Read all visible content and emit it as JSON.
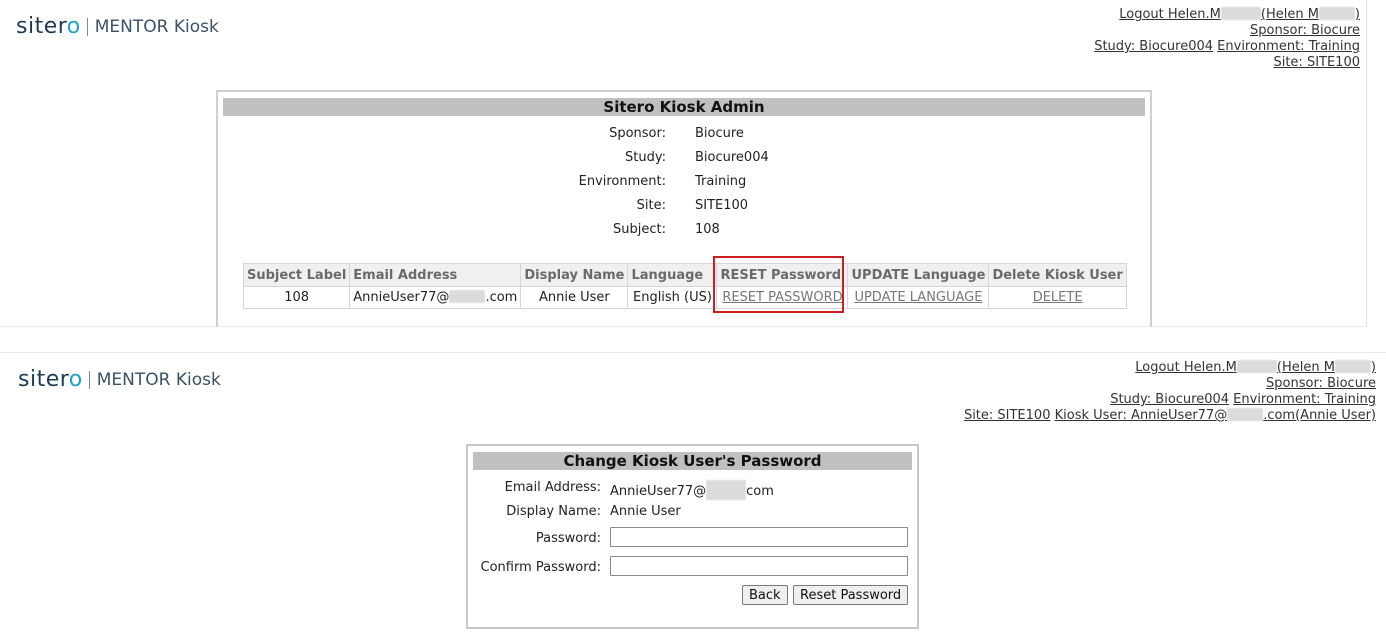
{
  "brand": {
    "name_left": "siter",
    "name_o": "o",
    "product": "MENTOR Kiosk"
  },
  "panel1": {
    "header": {
      "logout": "Logout Helen.M",
      "user_paren_open": "(Helen M",
      "user_paren_close": ")",
      "sponsor_link": "Sponsor: Biocure",
      "study_link": "Study: Biocure004",
      "environment_link": "Environment: Training",
      "site_link": "Site: SITE100"
    },
    "title": "Sitero Kiosk Admin",
    "details": [
      {
        "label": "Sponsor:",
        "value": "Biocure"
      },
      {
        "label": "Study:",
        "value": "Biocure004"
      },
      {
        "label": "Environment:",
        "value": "Training"
      },
      {
        "label": "Site:",
        "value": "SITE100"
      },
      {
        "label": "Subject:",
        "value": "108"
      }
    ],
    "table": {
      "headers": [
        "Subject Label",
        "Email Address",
        "Display Name",
        "Language",
        "RESET Password",
        "UPDATE Language",
        "Delete Kiosk User"
      ],
      "row": {
        "subject_label": "108",
        "email_prefix": "AnnieUser77@",
        "email_suffix": ".com",
        "display_name": "Annie User",
        "language": "English (US)",
        "reset_link": "RESET PASSWORD",
        "update_link": "UPDATE LANGUAGE",
        "delete_link": "DELETE"
      }
    },
    "highlight_color": "#cc1f1f"
  },
  "panel2": {
    "header": {
      "logout": "Logout Helen.M",
      "user_paren_open": "(Helen M",
      "user_paren_close": ")",
      "sponsor_link": "Sponsor: Biocure",
      "study_link": "Study: Biocure004",
      "environment_link": "Environment: Training",
      "site_link": "Site: SITE100",
      "kiosk_user_prefix": "Kiosk User: AnnieUser77@",
      "kiosk_user_suffix": ".com(Annie User)"
    },
    "title": "Change Kiosk User's Password",
    "email_label": "Email Address:",
    "email_prefix": "AnnieUser77@",
    "email_suffix": "com",
    "display_name_label": "Display Name:",
    "display_name_value": "Annie User",
    "password_label": "Password:",
    "password_value": "",
    "confirm_label": "Confirm Password:",
    "confirm_value": "",
    "back_button": "Back",
    "reset_button": "Reset Password"
  }
}
